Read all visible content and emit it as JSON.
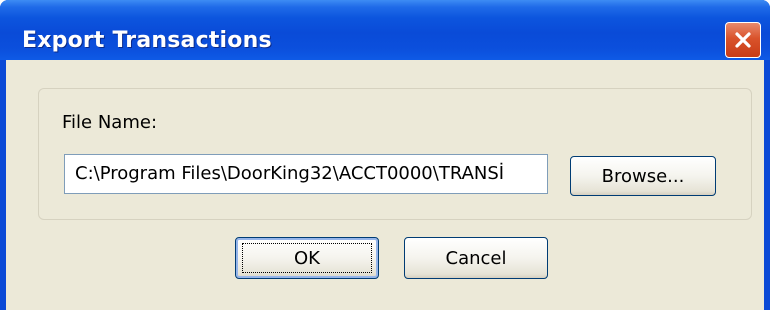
{
  "window": {
    "title": "Export Transactions",
    "close_icon": "close-icon"
  },
  "form": {
    "file_name_label": "File Name:",
    "file_name_value": "C:\\Program Files\\DoorKing32\\ACCT0000\\TRANSİ",
    "browse_label": "Browse..."
  },
  "buttons": {
    "ok_label": "OK",
    "cancel_label": "Cancel"
  },
  "colors": {
    "titlebar": "#0a4bd8",
    "dialog_face": "#ece9d8",
    "close_button": "#d9532b"
  }
}
